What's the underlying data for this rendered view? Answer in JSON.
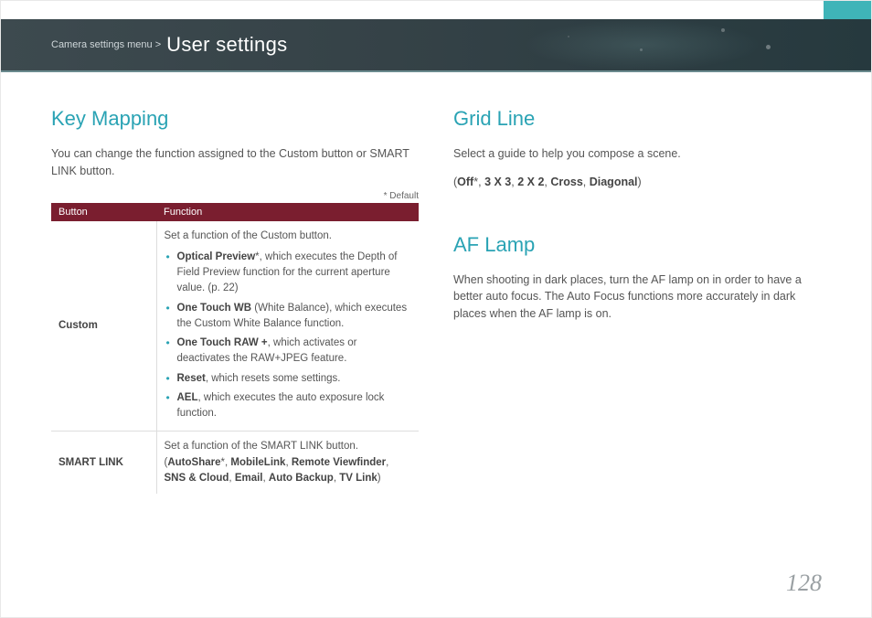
{
  "header": {
    "breadcrumb_prefix": "Camera settings menu >",
    "breadcrumb_title": "User settings"
  },
  "left": {
    "title": "Key Mapping",
    "intro": "You can change the function assigned to the Custom button or SMART LINK button.",
    "default_note": "* Default",
    "table": {
      "head_button": "Button",
      "head_function": "Function",
      "rows": [
        {
          "button": "Custom",
          "lead": "Set a function of the Custom button.",
          "items": [
            {
              "bold": "Optical Preview",
              "star": "*",
              "rest": ", which executes the Depth of Field Preview function for the current aperture value. (p. 22)"
            },
            {
              "bold": "One Touch WB",
              "star": "",
              "rest": " (White Balance), which executes the Custom White Balance function."
            },
            {
              "bold": "One Touch RAW +",
              "star": "",
              "rest": ", which activates or deactivates the RAW+JPEG feature."
            },
            {
              "bold": "Reset",
              "star": "",
              "rest": ", which resets some settings."
            },
            {
              "bold": "AEL",
              "star": "",
              "rest": ", which executes the auto exposure lock function."
            }
          ]
        },
        {
          "button": "SMART LINK",
          "lead": "Set a function of the SMART LINK button.",
          "options_prefix": "(",
          "options": "AutoShare*, MobileLink, Remote Viewfinder, SNS & Cloud, Email, Auto Backup, TV Link",
          "options_suffix": ")"
        }
      ]
    }
  },
  "right": {
    "grid_title": "Grid Line",
    "grid_body": "Select a guide to help you compose a scene.",
    "grid_options_prefix": "(",
    "grid_options": "Off*, 3 X 3, 2 X 2, Cross, Diagonal",
    "grid_options_suffix": ")",
    "af_title": "AF Lamp",
    "af_body": "When shooting in dark places, turn the AF lamp on in order to have a better auto focus. The Auto Focus functions more accurately in dark places when the AF lamp is on."
  },
  "page_number": "128"
}
